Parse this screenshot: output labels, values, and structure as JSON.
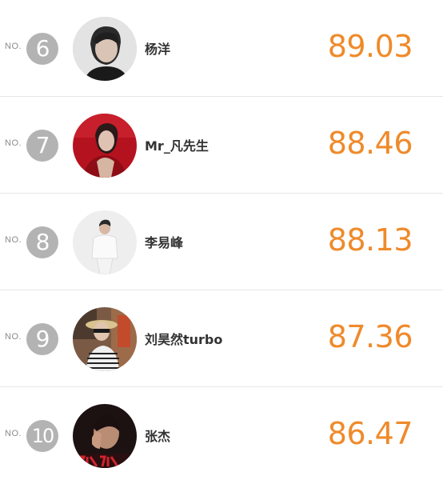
{
  "no_prefix": "NO.",
  "accent_color": "#ef8a2a",
  "rankings": [
    {
      "rank": "6",
      "name": "杨洋",
      "score": "89.03",
      "avatar": "avatar-photo-1"
    },
    {
      "rank": "7",
      "name": "Mr_凡先生",
      "score": "88.46",
      "avatar": "avatar-photo-2"
    },
    {
      "rank": "8",
      "name": "李易峰",
      "score": "88.13",
      "avatar": "avatar-photo-3"
    },
    {
      "rank": "9",
      "name": "刘昊然turbo",
      "score": "87.36",
      "avatar": "avatar-photo-4"
    },
    {
      "rank": "10",
      "name": "张杰",
      "score": "86.47",
      "avatar": "avatar-photo-5"
    }
  ]
}
